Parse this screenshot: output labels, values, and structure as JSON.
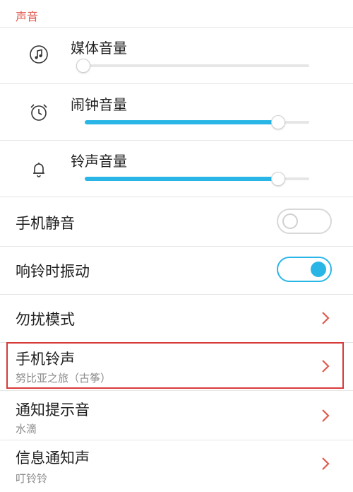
{
  "section": {
    "title": "声音"
  },
  "volumes": [
    {
      "label": "媒体音量",
      "icon": "music-note-icon",
      "level": 0.0
    },
    {
      "label": "闹钟音量",
      "icon": "alarm-clock-icon",
      "level": 0.88
    },
    {
      "label": "铃声音量",
      "icon": "bell-icon",
      "level": 0.88
    }
  ],
  "toggles": [
    {
      "label": "手机静音",
      "state": "off"
    },
    {
      "label": "响铃时振动",
      "state": "on"
    }
  ],
  "nav": [
    {
      "label": "勿扰模式",
      "sub": ""
    },
    {
      "label": "手机铃声",
      "sub": "努比亚之旅（古筝）",
      "highlighted": true
    },
    {
      "label": "通知提示音",
      "sub": "水滴"
    },
    {
      "label": "信息通知声",
      "sub": "叮铃铃"
    }
  ],
  "colors": {
    "accent": "#29b6e6",
    "section_title": "#e05a4e",
    "highlight_border": "#d83a3a",
    "chevron": "#e05a4e"
  }
}
